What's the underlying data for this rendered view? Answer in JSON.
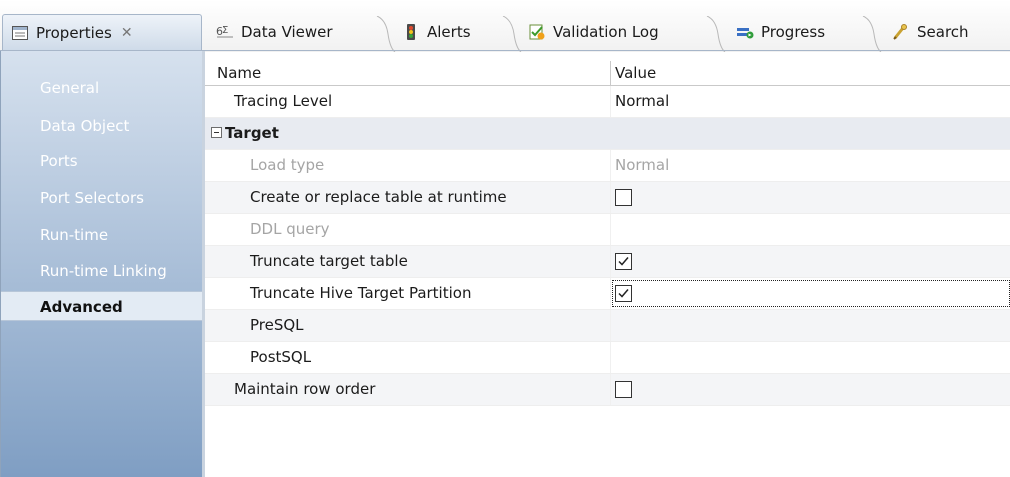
{
  "tabs": [
    {
      "label": "Properties",
      "icon": "properties-icon",
      "active": true,
      "close": "✕"
    },
    {
      "label": "Data Viewer",
      "icon": "data-viewer-icon"
    },
    {
      "label": "Alerts",
      "icon": "alerts-icon"
    },
    {
      "label": "Validation Log",
      "icon": "validation-log-icon"
    },
    {
      "label": "Progress",
      "icon": "progress-icon"
    },
    {
      "label": "Search",
      "icon": "search-icon"
    }
  ],
  "sidebar": {
    "items": [
      {
        "label": "General"
      },
      {
        "label": "Data Object"
      },
      {
        "label": "Ports"
      },
      {
        "label": "Port Selectors"
      },
      {
        "label": "Run-time"
      },
      {
        "label": "Run-time Linking"
      },
      {
        "label": "Advanced",
        "selected": true
      }
    ]
  },
  "grid": {
    "headers": {
      "name": "Name",
      "value": "Value"
    },
    "rows": [
      {
        "name": "Tracing Level",
        "value": "Normal"
      },
      {
        "name": "Target",
        "group": true
      },
      {
        "name": "Load type",
        "value": "Normal",
        "disabled": true
      },
      {
        "name": "Create or replace table at runtime",
        "checkbox": false
      },
      {
        "name": "DDL query",
        "value": "",
        "disabled": true
      },
      {
        "name": "Truncate target table",
        "checkbox": true
      },
      {
        "name": "Truncate Hive Target Partition",
        "checkbox": true,
        "focused": true
      },
      {
        "name": "PreSQL",
        "value": ""
      },
      {
        "name": "PostSQL",
        "value": ""
      },
      {
        "name": "Maintain row order",
        "checkbox": false
      }
    ]
  },
  "colors": {
    "accent": "#cfdbe9",
    "sidebar_top": "#d6e1ee",
    "sidebar_bottom": "#7f9ec3"
  }
}
